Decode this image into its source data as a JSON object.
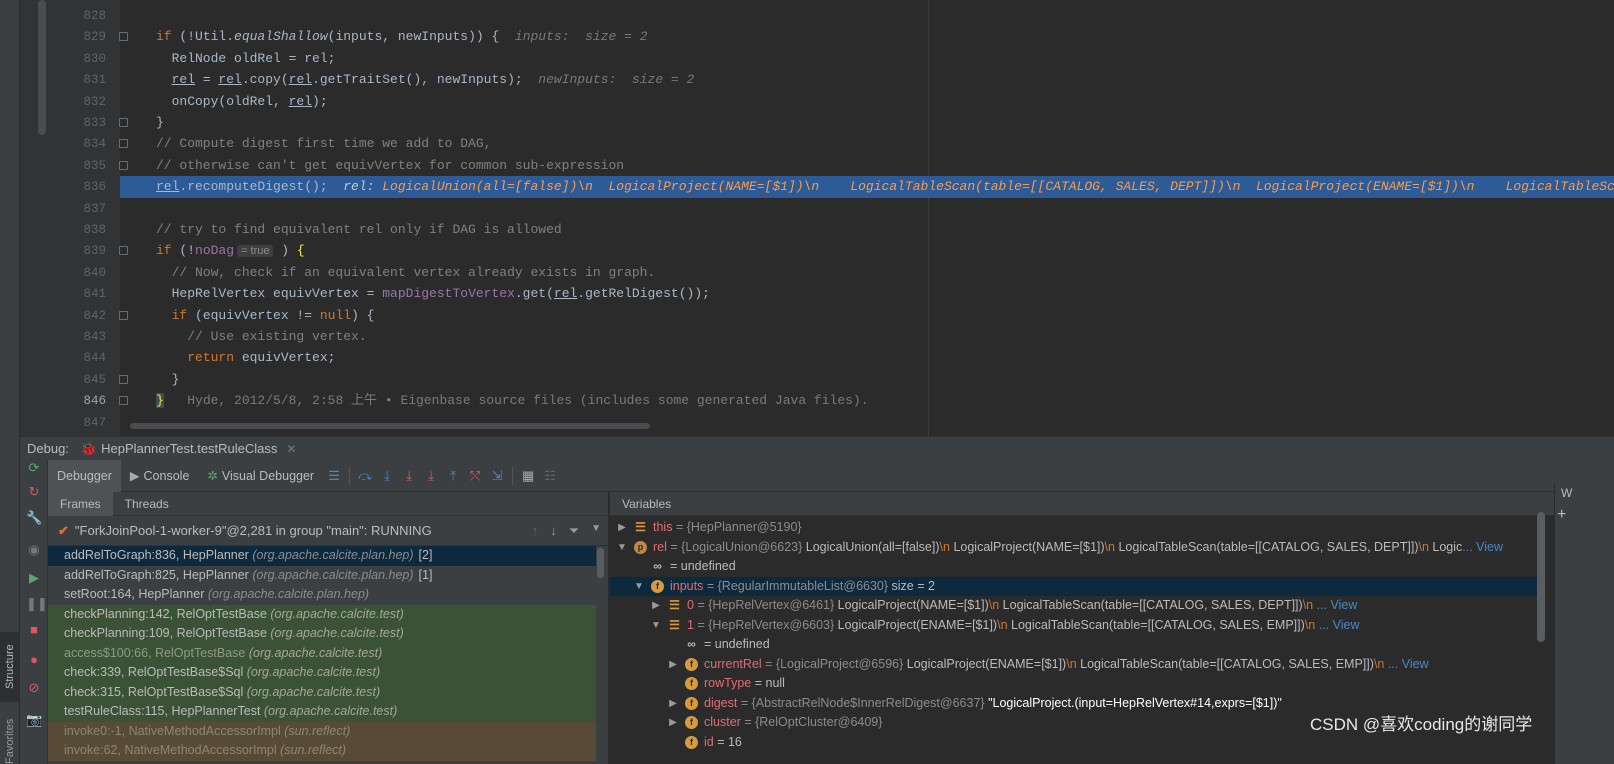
{
  "editor": {
    "lines": [
      {
        "num": "828",
        "html": ""
      },
      {
        "num": "829",
        "html": "<span class=\"kw\">if</span> (!Util.<span class=\"it\">equalShallow</span>(inputs, newInputs)) {  <span class=\"hint\">inputs:  size = 2</span>"
      },
      {
        "num": "830",
        "html": "  RelNode oldRel = rel;"
      },
      {
        "num": "831",
        "html": "  <span class=\"ul\">rel</span> = <span class=\"ul\">rel</span>.copy(<span class=\"ul\">rel</span>.getTraitSet(), newInputs);  <span class=\"hint\">newInputs:  size = 2</span>"
      },
      {
        "num": "832",
        "html": "  onCopy(oldRel, <span class=\"ul\">rel</span>);"
      },
      {
        "num": "833",
        "html": "}"
      },
      {
        "num": "834",
        "html": "<span class=\"cm\">// Compute digest first time we add to DAG,</span>"
      },
      {
        "num": "835",
        "html": "<span class=\"cm\">// otherwise can't get equivVertex for common sub-expression</span>"
      },
      {
        "num": "836",
        "html": "<span class=\"ul\">rel</span>.recomputeDigest();  <span class=\"hint\" style=\"color:#c8c8c8\">rel: </span><span class=\"hintc\">LogicalUnion(all=[false])\\n  LogicalProject(NAME=[$1])\\n    LogicalTableScan(table=[[CATALOG, SALES, DEPT]])\\n  LogicalProject(ENAME=[$1])\\n    LogicalTableScan(table=[[CATALOG, SALES, EMP]])</span>"
      },
      {
        "num": "837",
        "html": ""
      },
      {
        "num": "838",
        "html": "<span class=\"cm\">// try to find equivalent rel only if DAG is allowed</span>"
      },
      {
        "num": "839",
        "html": "<span class=\"kw\">if</span> (!<span class=\"fd\">noDag</span><span class=\"pill\">= true</span> ) <span style=\"color:#ffef28\">{</span>"
      },
      {
        "num": "840",
        "html": "  <span class=\"cm\">// Now, check if an equivalent vertex already exists in graph.</span>"
      },
      {
        "num": "841",
        "html": "  HepRelVertex equivVertex = <span class=\"fd\">mapDigestToVertex</span>.get(<span class=\"ul\">rel</span>.getRelDigest());"
      },
      {
        "num": "842",
        "html": "  <span class=\"kw\">if</span> (equivVertex != <span class=\"kw\">null</span>) {"
      },
      {
        "num": "843",
        "html": "    <span class=\"cm\">// Use existing vertex.</span>"
      },
      {
        "num": "844",
        "html": "    <span class=\"kw\">return</span> equivVertex;"
      },
      {
        "num": "845",
        "html": "  }"
      },
      {
        "num": "846",
        "html": "<span style=\"color:#ffef28;background:#3b514d\">}</span>   <span class=\"hint\" style=\"font-style:normal;color:#7a7a7a\">Hyde, 2012/5/8, 2:58 上午 • Eigenbase source files (includes some generated Java files).</span>"
      },
      {
        "num": "847",
        "html": ""
      }
    ]
  },
  "debug": {
    "label": "Debug:",
    "session_tab": "HepPlannerTest.testRuleClass",
    "toolbar": {
      "debugger_tab": "Debugger",
      "console_tab": "Console",
      "visual_tab": "Visual Debugger"
    },
    "frames": {
      "tab_frames": "Frames",
      "tab_threads": "Threads",
      "thread": "\"ForkJoinPool-1-worker-9\"@2,281 in group \"main\": RUNNING",
      "items": [
        {
          "method": "addRelToGraph:836, HepPlanner",
          "pkg": "(org.apache.calcite.plan.hep)",
          "idx": "[2]",
          "kind": "sel"
        },
        {
          "method": "addRelToGraph:825, HepPlanner",
          "pkg": "(org.apache.calcite.plan.hep)",
          "idx": "[1]",
          "kind": "normal"
        },
        {
          "method": "setRoot:164, HepPlanner",
          "pkg": "(org.apache.calcite.plan.hep)",
          "idx": "",
          "kind": "normal"
        },
        {
          "method": "checkPlanning:142, RelOptTestBase",
          "pkg": "(org.apache.calcite.test)",
          "idx": "",
          "kind": "lib"
        },
        {
          "method": "checkPlanning:109, RelOptTestBase",
          "pkg": "(org.apache.calcite.test)",
          "idx": "",
          "kind": "lib"
        },
        {
          "method": "access$100:66, RelOptTestBase",
          "pkg": "(org.apache.calcite.test)",
          "idx": "",
          "kind": "lib dim"
        },
        {
          "method": "check:339, RelOptTestBase$Sql",
          "pkg": "(org.apache.calcite.test)",
          "idx": "",
          "kind": "lib"
        },
        {
          "method": "check:315, RelOptTestBase$Sql",
          "pkg": "(org.apache.calcite.test)",
          "idx": "",
          "kind": "lib"
        },
        {
          "method": "testRuleClass:115, HepPlannerTest",
          "pkg": "(org.apache.calcite.test)",
          "idx": "",
          "kind": "lib"
        },
        {
          "method": "invoke0:-1, NativeMethodAccessorImpl",
          "pkg": "(sun.reflect)",
          "idx": "",
          "kind": "nat"
        },
        {
          "method": "invoke:62, NativeMethodAccessorImpl",
          "pkg": "(sun.reflect)",
          "idx": "",
          "kind": "nat"
        }
      ]
    },
    "variables": {
      "header": "Variables",
      "right_label": "W",
      "items": [
        {
          "depth": 0,
          "arrow": "▶",
          "icon": "list",
          "name": "this",
          "rest": "<span class=\"vtype\">= {HepPlanner@5190}</span>"
        },
        {
          "depth": 0,
          "arrow": "▼",
          "icon": "p",
          "name": "rel",
          "rest": "<span class=\"vtype\">= {LogicalUnion@6623} </span>LogicalUnion(all=[false])<span class=\"vesc\">\\n</span>  LogicalProject(NAME=[$1])<span class=\"vesc\">\\n</span>    LogicalTableScan(table=[[CATALOG, SALES, DEPT]])<span class=\"vesc\">\\n</span>  Logic<span class=\"vlink\">... View</span>"
        },
        {
          "depth": 1,
          "arrow": "",
          "icon": "inf",
          "name": "",
          "rest": "= undefined"
        },
        {
          "depth": 1,
          "arrow": "▼",
          "icon": "f",
          "name": "inputs",
          "rest": "<span class=\"vtype\">= {RegularImmutableList@6630} </span> size = 2",
          "sel": true
        },
        {
          "depth": 2,
          "arrow": "▶",
          "icon": "list",
          "name": "0",
          "rest": "<span class=\"vtype\">= {HepRelVertex@6461} </span>LogicalProject(NAME=[$1])<span class=\"vesc\">\\n</span>  LogicalTableScan(table=[[CATALOG, SALES, DEPT]])<span class=\"vesc\">\\n</span><span class=\"vlink\"> ... View</span>"
        },
        {
          "depth": 2,
          "arrow": "▼",
          "icon": "list",
          "name": "1",
          "rest": "<span class=\"vtype\">= {HepRelVertex@6603} </span>LogicalProject(ENAME=[$1])<span class=\"vesc\">\\n</span>  LogicalTableScan(table=[[CATALOG, SALES, EMP]])<span class=\"vesc\">\\n</span><span class=\"vlink\"> ... View</span>"
        },
        {
          "depth": 3,
          "arrow": "",
          "icon": "inf",
          "name": "",
          "rest": "= undefined"
        },
        {
          "depth": 3,
          "arrow": "▶",
          "icon": "f",
          "name": "currentRel",
          "rest": "<span class=\"vtype\">= {LogicalProject@6596} </span>LogicalProject(ENAME=[$1])<span class=\"vesc\">\\n</span>  LogicalTableScan(table=[[CATALOG, SALES, EMP]])<span class=\"vesc\">\\n</span><span class=\"vlink\"> ... View</span>"
        },
        {
          "depth": 3,
          "arrow": "",
          "icon": "f",
          "name": "rowType",
          "rest": "= null"
        },
        {
          "depth": 3,
          "arrow": "▶",
          "icon": "f",
          "name": "digest",
          "rest": "<span class=\"vtype\">= {AbstractRelNode$InnerRelDigest@6637} </span><span class=\"vstr\">\"LogicalProject.(input=HepRelVertex#14,exprs=[$1])\"</span>"
        },
        {
          "depth": 3,
          "arrow": "▶",
          "icon": "f",
          "name": "cluster",
          "rest": "<span class=\"vtype\">= {RelOptCluster@6409}</span>"
        },
        {
          "depth": 3,
          "arrow": "",
          "icon": "f",
          "name": "id",
          "rest": "= 16"
        }
      ]
    }
  },
  "sidebar": {
    "structure": "Structure",
    "favorites": "Favorites"
  },
  "watermark": "CSDN @喜欢coding的谢同学"
}
